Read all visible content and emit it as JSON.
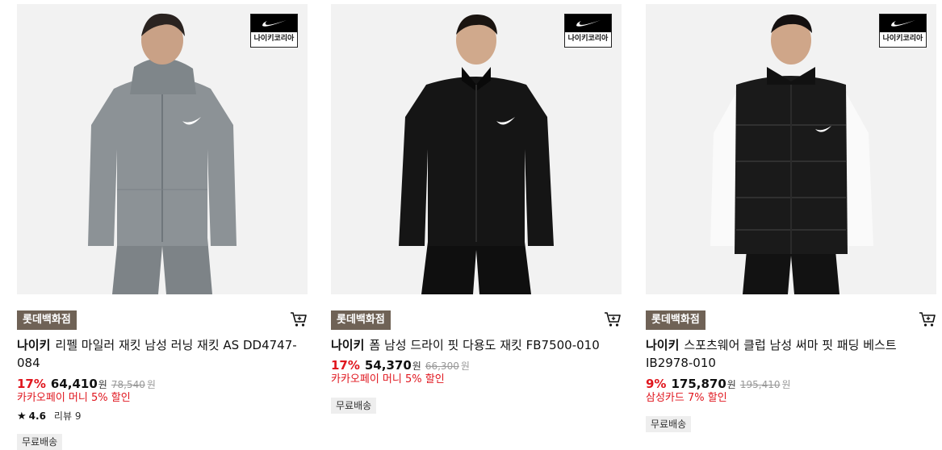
{
  "brand_badge_text": "나이키코리아",
  "products": [
    {
      "store_tag": "롯데백화점",
      "brand": "나이키",
      "title": "리펠 마일러 재킷 남성 러닝 재킷 AS DD4747-084",
      "discount": "17%",
      "price": "64,410",
      "price_unit": "원",
      "original_price": "78,540",
      "original_unit": "원",
      "promo": "카카오페이 머니 5% 할인",
      "rating": "4.6",
      "review_label": "리뷰 9",
      "shipping": "무료배송",
      "image_alt": "grey hooded running jacket",
      "colors": {
        "bg": "#f2f2f2",
        "garment": "#8c9296",
        "garment_dark": "#6f767b",
        "skin": "#c9a186",
        "hair": "#2a2320"
      }
    },
    {
      "store_tag": "롯데백화점",
      "brand": "나이키",
      "title": "폼 남성 드라이 핏 다용도 재킷 FB7500-010",
      "discount": "17%",
      "price": "54,370",
      "price_unit": "원",
      "original_price": "66,300",
      "original_unit": "원",
      "promo": "카카오페이 머니 5% 할인",
      "shipping": "무료배송",
      "image_alt": "black track jacket",
      "colors": {
        "bg": "#f2f2f2",
        "garment": "#151515",
        "garment_dark": "#050505",
        "skin": "#d0a98c",
        "hair": "#1a1410"
      }
    },
    {
      "store_tag": "롯데백화점",
      "brand": "나이키",
      "title": "스포츠웨어 클럽 남성 써마 핏 패딩 베스트 IB2978-010",
      "discount": "9%",
      "price": "175,870",
      "price_unit": "원",
      "original_price": "195,410",
      "original_unit": "원",
      "promo": "삼성카드 7% 할인",
      "shipping": "무료배송",
      "image_alt": "black puffer vest over white sweatshirt",
      "colors": {
        "bg": "#f2f2f2",
        "garment": "#1a1a1a",
        "garment_dark": "#000000",
        "skin": "#cfa689",
        "hair": "#141010"
      }
    }
  ],
  "icons": {
    "cart": "cart-icon",
    "star": "star-icon",
    "swoosh": "nike-swoosh-icon"
  }
}
